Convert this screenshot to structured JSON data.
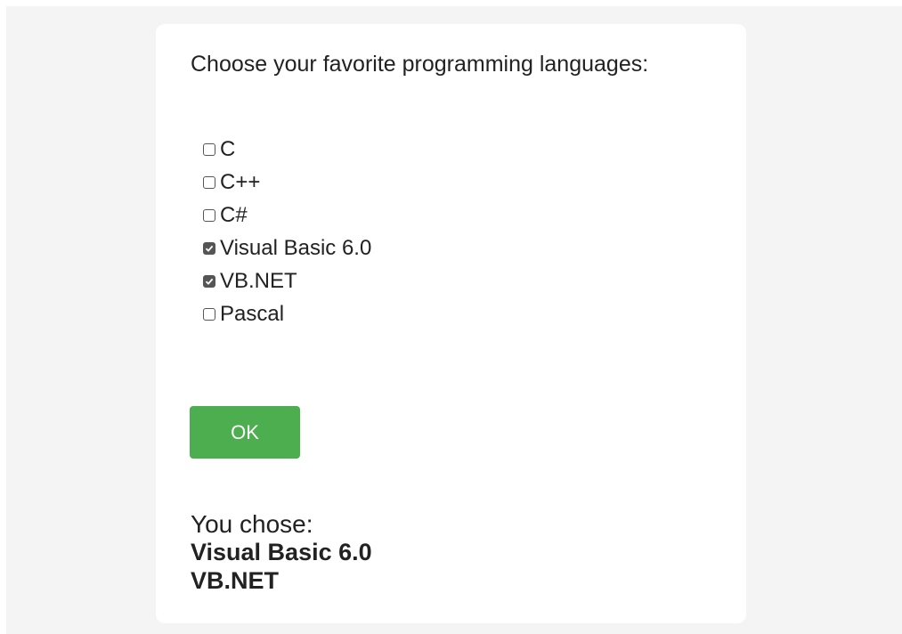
{
  "page": {
    "prompt": "Choose your favorite programming languages:"
  },
  "options": [
    {
      "label": "C",
      "checked": false
    },
    {
      "label": "C++",
      "checked": false
    },
    {
      "label": "C#",
      "checked": false
    },
    {
      "label": "Visual Basic 6.0",
      "checked": true
    },
    {
      "label": "VB.NET",
      "checked": true
    },
    {
      "label": "Pascal",
      "checked": false
    }
  ],
  "button": {
    "ok_label": "OK"
  },
  "result": {
    "label": "You chose:",
    "items": [
      "Visual Basic 6.0",
      "VB.NET"
    ]
  },
  "colors": {
    "button_bg": "#4cae4f",
    "page_bg": "#f4f4f4",
    "card_bg": "#ffffff"
  }
}
